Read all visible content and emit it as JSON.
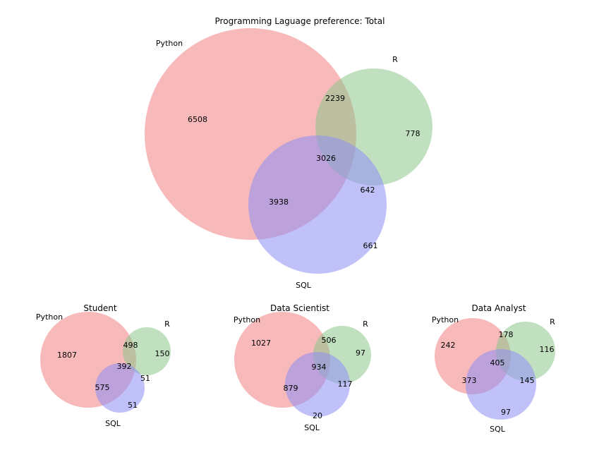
{
  "chart_data": [
    {
      "type": "venn3",
      "title": "Programming Laguage preference: Total",
      "sets": {
        "A": "Python",
        "B": "R",
        "C": "SQL"
      },
      "regions": {
        "A_only": 6508,
        "B_only": 778,
        "C_only": 661,
        "A_and_B_only": 2239,
        "A_and_C_only": 3938,
        "B_and_C_only": 642,
        "A_and_B_and_C": 3026
      }
    },
    {
      "type": "venn3",
      "title": "Student",
      "sets": {
        "A": "Python",
        "B": "R",
        "C": "SQL"
      },
      "regions": {
        "A_only": 1807,
        "B_only": 150,
        "C_only": 51,
        "A_and_B_only": 498,
        "A_and_C_only": 575,
        "B_and_C_only": 51,
        "A_and_B_and_C": 392
      }
    },
    {
      "type": "venn3",
      "title": "Data Scientist",
      "sets": {
        "A": "Python",
        "B": "R",
        "C": "SQL"
      },
      "regions": {
        "A_only": 1027,
        "B_only": 97,
        "C_only": 20,
        "A_and_B_only": 506,
        "A_and_C_only": 879,
        "B_and_C_only": 117,
        "A_and_B_and_C": 934
      }
    },
    {
      "type": "venn3",
      "title": "Data Analyst",
      "sets": {
        "A": "Python",
        "B": "R",
        "C": "SQL"
      },
      "regions": {
        "A_only": 242,
        "B_only": 116,
        "C_only": 97,
        "A_and_B_only": 178,
        "A_and_C_only": 373,
        "B_and_C_only": 145,
        "A_and_B_and_C": 405
      }
    }
  ],
  "colors": {
    "A": "#f08080",
    "B": "#8dc78d",
    "C": "#8e8ef5",
    "AB": "#d0b77c",
    "AC": "#c47bc7",
    "BC": "#7e9cc6",
    "ABC": "#aa93ab"
  }
}
